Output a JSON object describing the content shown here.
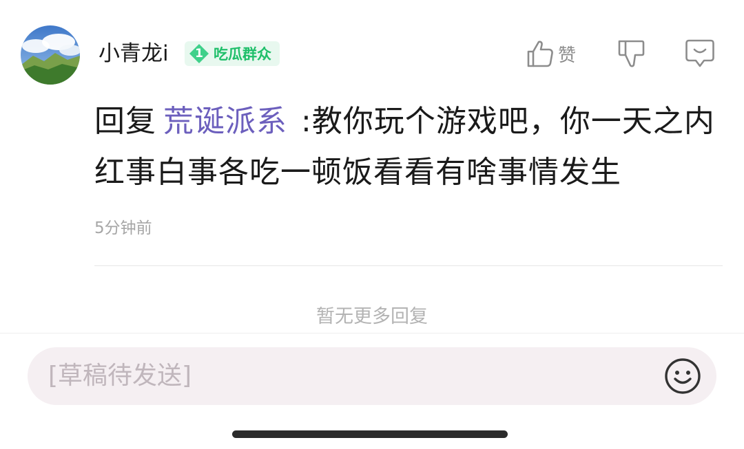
{
  "comment": {
    "username": "小青龙i",
    "badge": {
      "level": "1",
      "title": "吃瓜群众",
      "color": "#1fbf6a"
    },
    "actions": {
      "like_label": "赞"
    },
    "reply_prefix": "回复",
    "mention": "荒诞派系",
    "text": ":教你玩个游戏吧，你一天之内红事白事各吃一顿饭看看有啥事情发生",
    "time": "5分钟前"
  },
  "footer": {
    "no_more_text": "暂无更多回复"
  },
  "input": {
    "placeholder": "[草稿待发送]"
  },
  "colors": {
    "mention": "#6c5fbd",
    "badge_bg": "#e8f8ef",
    "input_bg": "#f5eff2"
  },
  "icons": {
    "like": "thumbs-up-icon",
    "dislike": "thumbs-down-icon",
    "reply": "comment-icon",
    "emoji": "smiley-icon"
  }
}
